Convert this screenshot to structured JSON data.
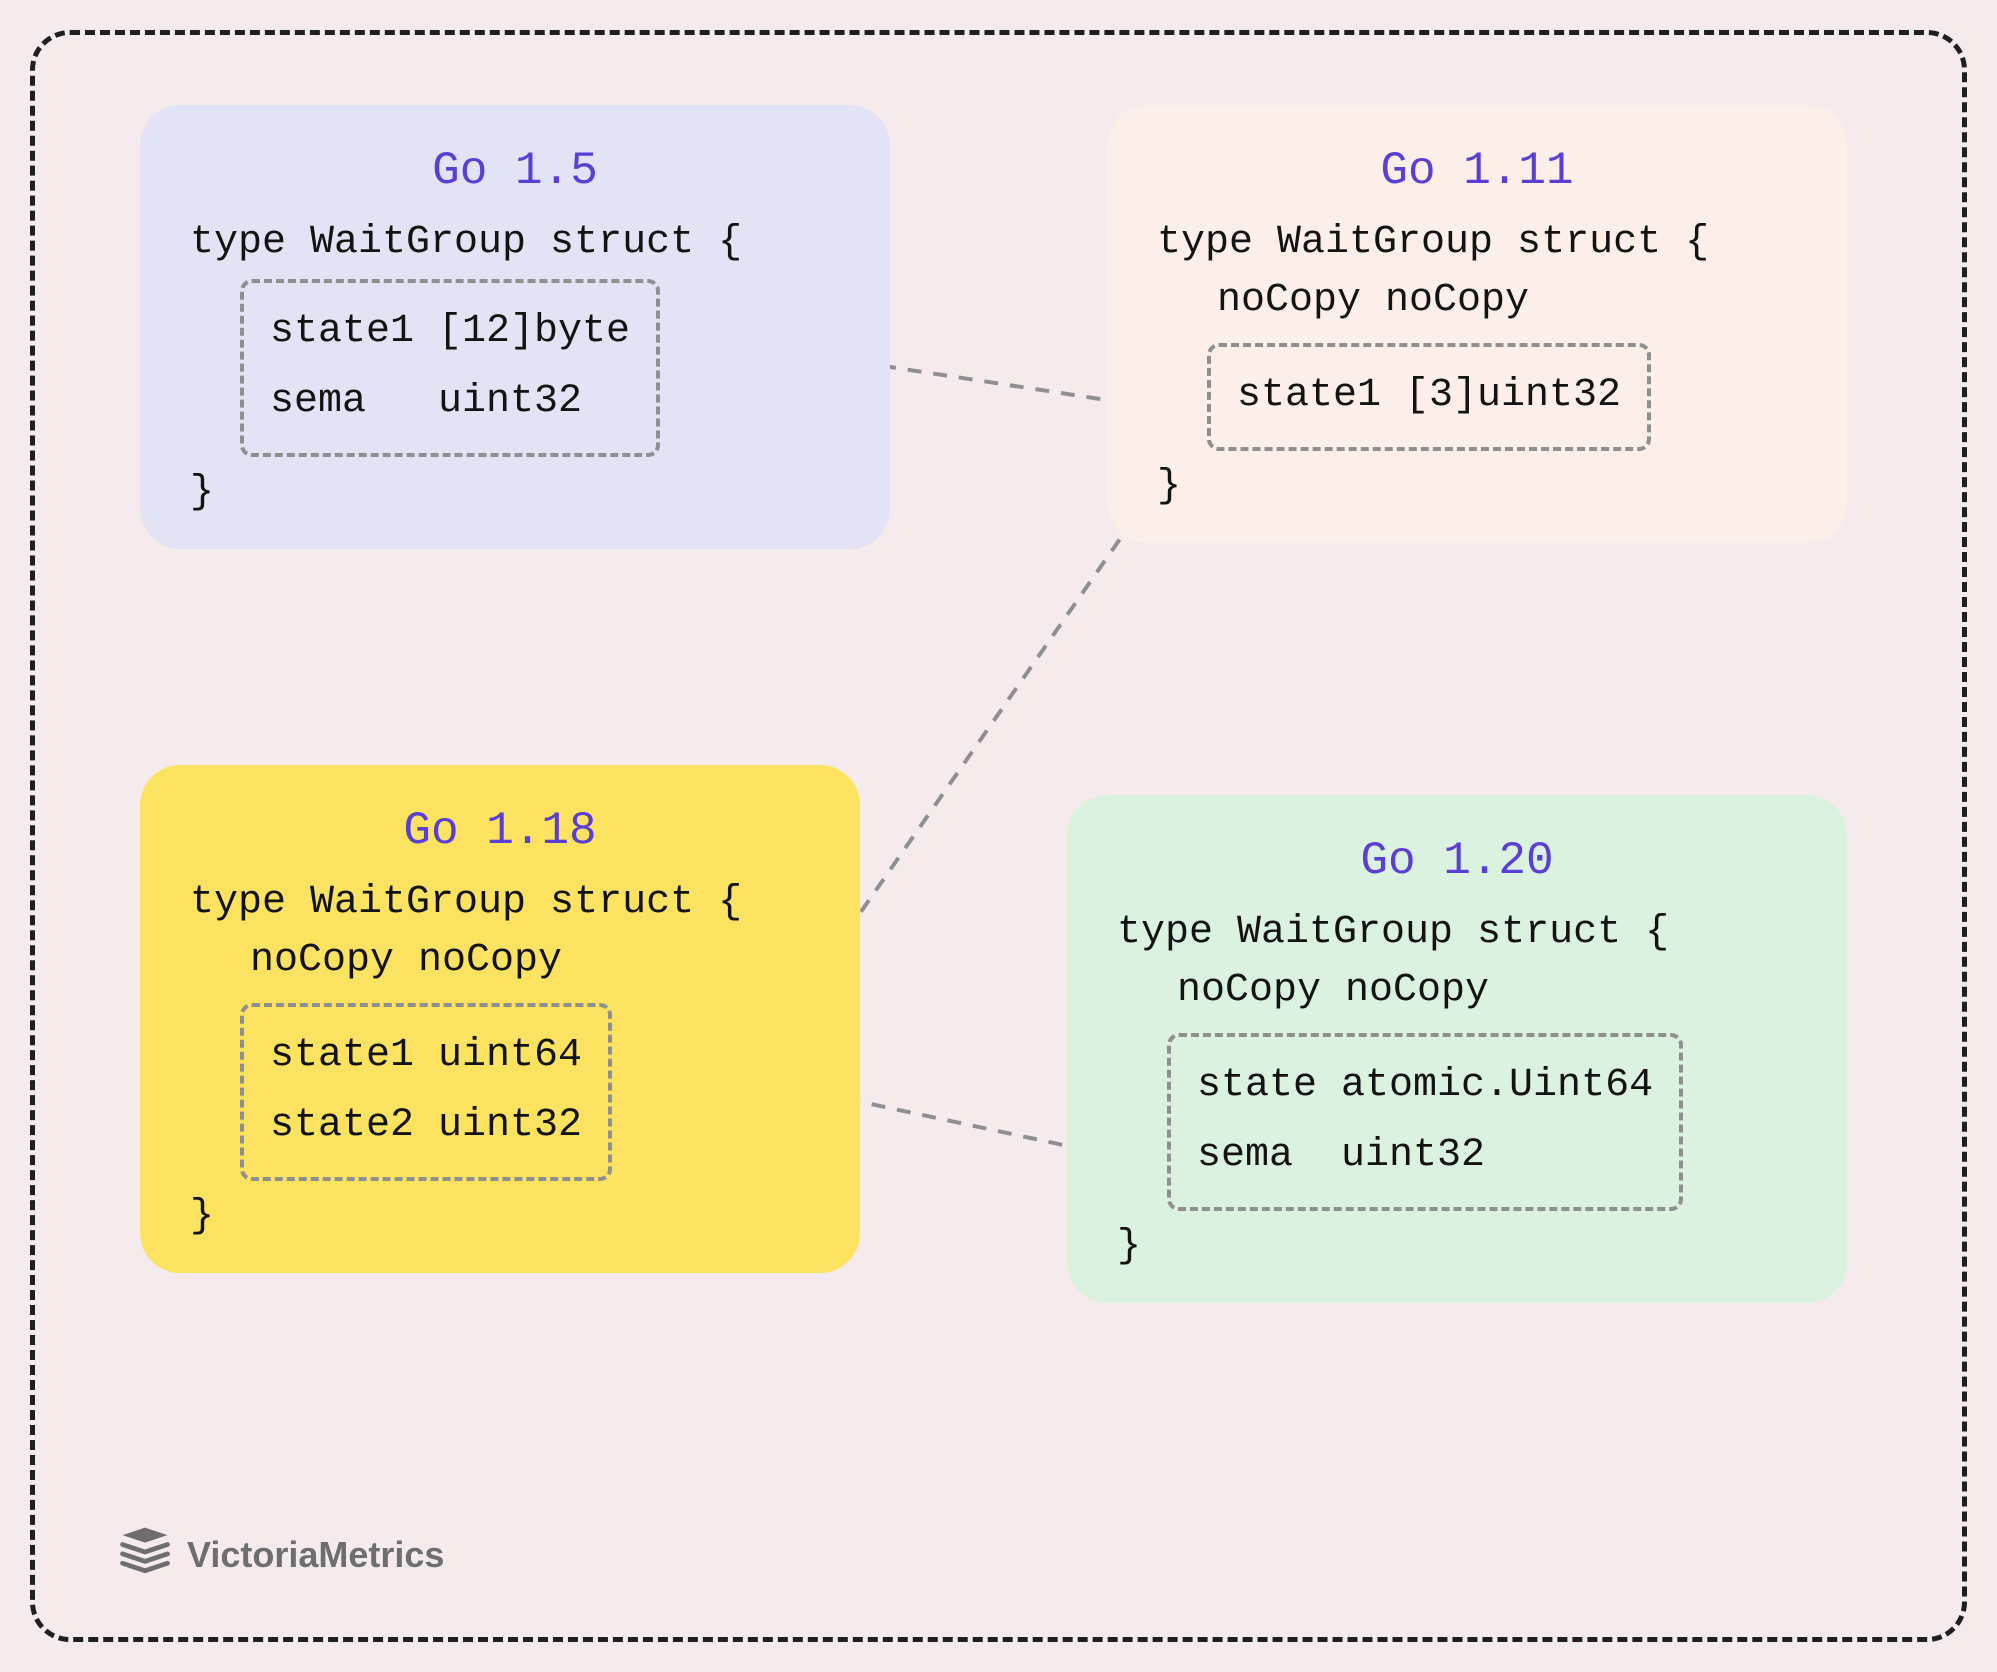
{
  "panels": {
    "go15": {
      "title": "Go 1.5",
      "open": "type WaitGroup struct {",
      "field1": "state1 [12]byte",
      "field2": "sema   uint32",
      "close": "}"
    },
    "go111": {
      "title": "Go 1.11",
      "open": "type WaitGroup struct {",
      "nocopy": "noCopy noCopy",
      "field1": "state1 [3]uint32",
      "close": "}"
    },
    "go118": {
      "title": "Go 1.18",
      "open": "type WaitGroup struct {",
      "nocopy": "noCopy noCopy",
      "field1": "state1 uint64",
      "field2": "state2 uint32",
      "close": "}"
    },
    "go120": {
      "title": "Go 1.20",
      "open": "type WaitGroup struct {",
      "nocopy": "noCopy noCopy",
      "field1": "state atomic.Uint64",
      "field2": "sema  uint32",
      "close": "}"
    }
  },
  "brand": {
    "text": "VictoriaMetrics"
  }
}
